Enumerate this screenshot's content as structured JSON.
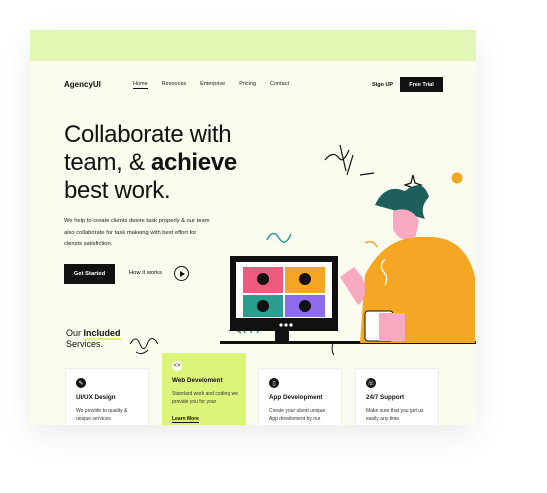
{
  "nav": {
    "logo": "AgencyUI",
    "links": [
      "Home",
      "Resouces",
      "Enterprise",
      "Pricing",
      "Contact"
    ],
    "signup": "Sign UP",
    "trial": "Free Trial"
  },
  "hero": {
    "line1": "Collaborate with",
    "line2_a": "team, & ",
    "line2_b": "achieve",
    "line3": "best work.",
    "desc": "We help to create clients desire task properly & our team also collaborate for task makeing with best effort for clensts satisfiction.",
    "cta": "Get Started",
    "how": "How it works"
  },
  "services": {
    "title_a": "Our ",
    "title_b": "Included",
    "title_c": "Services.",
    "cards": [
      {
        "title": "UI/UX Design",
        "desc": "We provide to quality & unique services"
      },
      {
        "title": "Web Develoment",
        "desc": "Standard work and coding we provide you for your",
        "more": "Learn More"
      },
      {
        "title": "App Development",
        "desc": "Create your ubest unique App develoment by our"
      },
      {
        "title": "24/7 Support",
        "desc": "Make sure that you get us easily any time."
      }
    ]
  },
  "colors": {
    "accent": "#dbf57a",
    "topbar": "#e3f7b4",
    "dark": "#111111",
    "orange": "#f5a623",
    "teal": "#2a9d8f"
  }
}
